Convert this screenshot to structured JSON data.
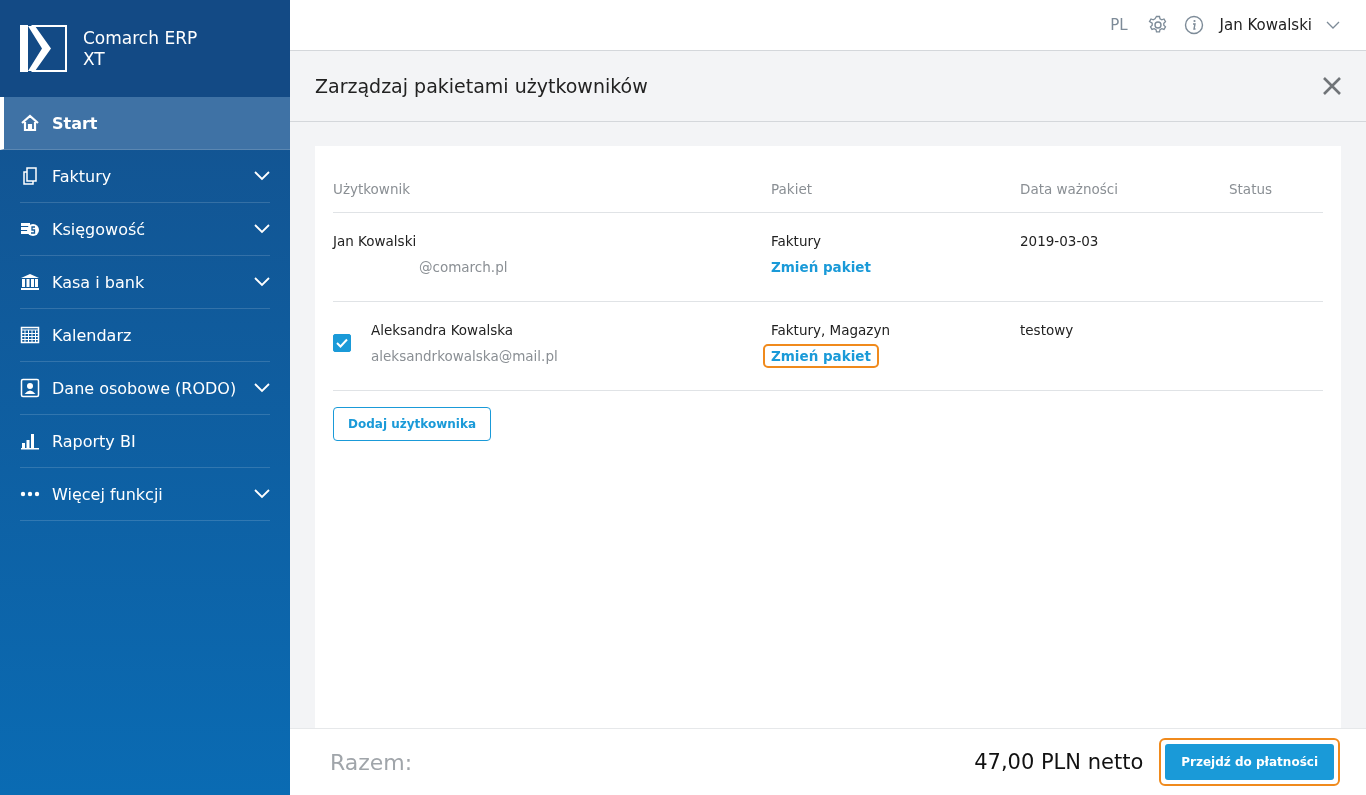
{
  "brand": {
    "name": "Comarch ERP XT"
  },
  "sidebar": {
    "items": [
      {
        "label": "Start",
        "selected": true,
        "expandable": false
      },
      {
        "label": "Faktury",
        "selected": false,
        "expandable": true
      },
      {
        "label": "Księgowość",
        "selected": false,
        "expandable": true
      },
      {
        "label": "Kasa i bank",
        "selected": false,
        "expandable": true
      },
      {
        "label": "Kalendarz",
        "selected": false,
        "expandable": false
      },
      {
        "label": "Dane osobowe (RODO)",
        "selected": false,
        "expandable": true
      },
      {
        "label": "Raporty BI",
        "selected": false,
        "expandable": false
      },
      {
        "label": "Więcej funkcji",
        "selected": false,
        "expandable": true
      }
    ]
  },
  "topbar": {
    "language": "PL",
    "user": "Jan Kowalski"
  },
  "panel": {
    "title": "Zarządzaj pakietami użytkowników",
    "table": {
      "columns": [
        "Użytkownik",
        "Pakiet",
        "Data ważności",
        "Status"
      ],
      "rows": [
        {
          "kind": "owner",
          "name": "Jan Kowalski",
          "email": "@comarch.pl",
          "package": "Faktury",
          "change_link": "Zmień pakiet",
          "highlighted": false,
          "expiry": "2019-03-03"
        },
        {
          "kind": "selectable",
          "checked": true,
          "name": "Aleksandra Kowalska",
          "email": "aleksandrkowalska@mail.pl",
          "package": "Faktury, Magazyn",
          "change_link": "Zmień pakiet",
          "highlighted": true,
          "expiry": "testowy"
        }
      ]
    },
    "add_button": "Dodaj użytkownika"
  },
  "footer": {
    "label": "Razem:",
    "total": "47,00 PLN netto",
    "pay_button": "Przejdź do płatności",
    "pay_highlighted": true
  }
}
